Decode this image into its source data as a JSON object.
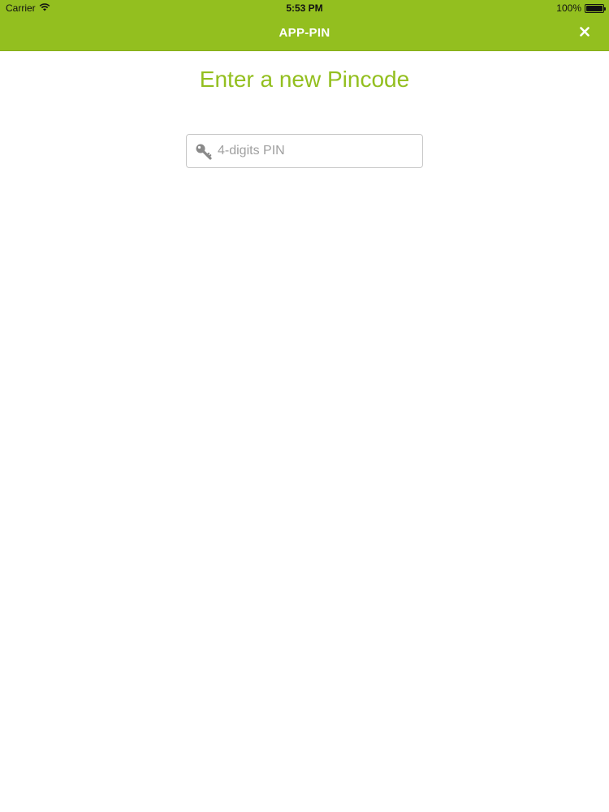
{
  "status_bar": {
    "carrier": "Carrier",
    "time": "5:53 PM",
    "battery": "100%",
    "battery_level": 1.0
  },
  "nav": {
    "title": "APP-PIN",
    "close_icon": "close-icon"
  },
  "main": {
    "heading": "Enter a new Pincode",
    "pin_input": {
      "placeholder": "4-digits PIN",
      "value": "",
      "icon": "key-icon"
    }
  },
  "colors": {
    "brand": "#93bf1f",
    "heading": "#93bf1f",
    "nav_text": "#ffffff",
    "placeholder": "#a0a0a0",
    "icon": "#8a8a8a"
  }
}
